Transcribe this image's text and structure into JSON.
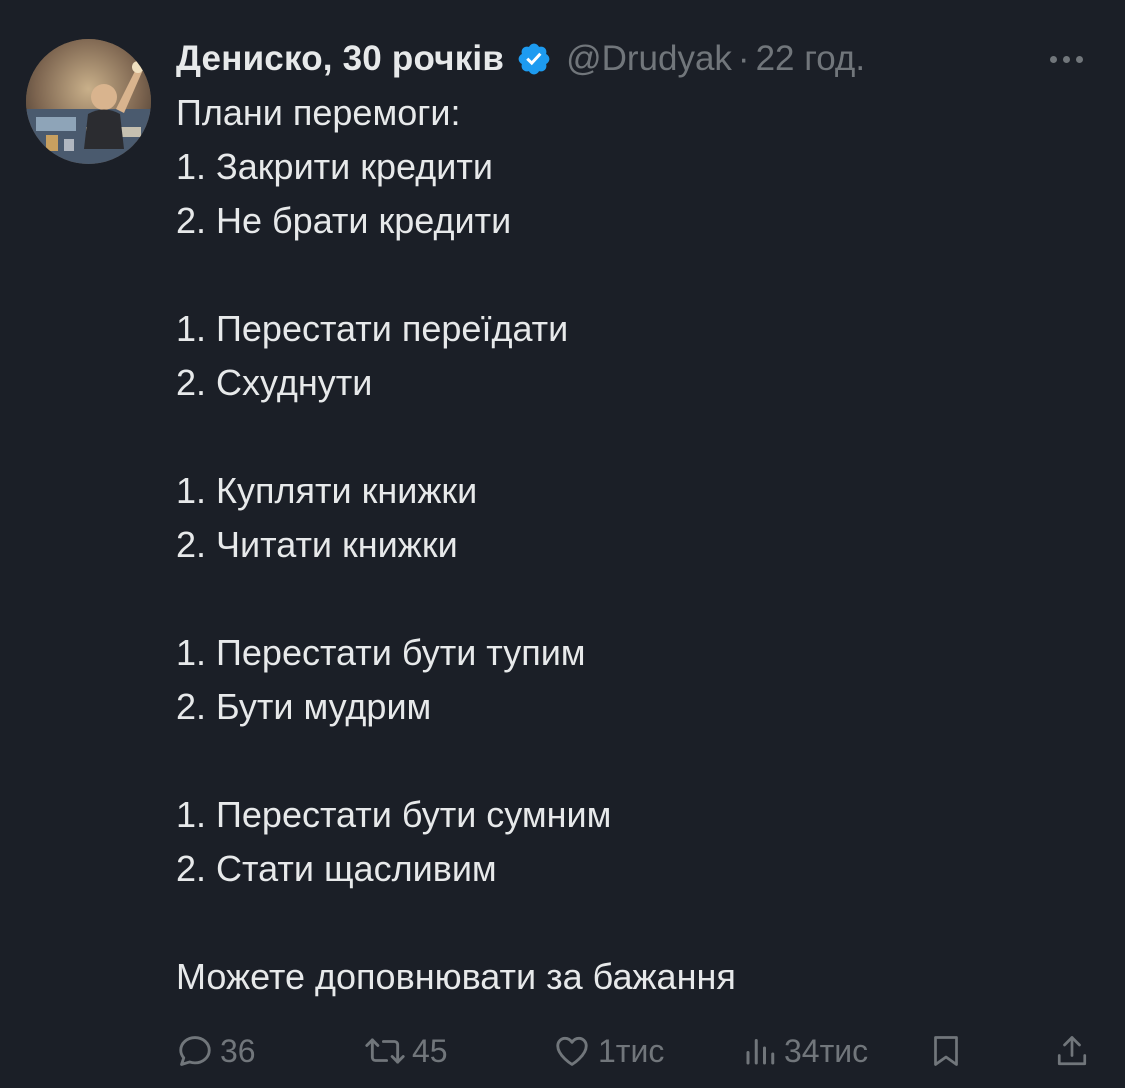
{
  "author": {
    "display_name": "Дениско, 30 рочків",
    "handle": "@Drudyak",
    "separator": "·",
    "time": "22 год."
  },
  "icons": {
    "verified": "verified-badge-icon",
    "more": "more-options-icon",
    "reply": "reply-icon",
    "retweet": "retweet-icon",
    "like": "like-icon",
    "views": "views-icon",
    "bookmark": "bookmark-icon",
    "share": "share-icon"
  },
  "colors": {
    "background": "#1b1f27",
    "text": "#e7e9ea",
    "muted": "#71767b",
    "verified": "#1d9bf0"
  },
  "tweet": {
    "lines": [
      "Плани перемоги:",
      "1. Закрити кредити",
      "2. Не брати кредити",
      "",
      "1. Перестати переїдати",
      "2. Схуднути",
      "",
      "1. Купляти книжки",
      "2. Читати книжки",
      "",
      "1. Перестати бути тупим",
      "2. Бути мудрим",
      "",
      "1. Перестати бути сумним",
      "2. Стати щасливим",
      "",
      "Можете доповнювати за бажання"
    ]
  },
  "stats": {
    "replies": "36",
    "retweets": "45",
    "likes": "1тис",
    "views": "34тис"
  }
}
